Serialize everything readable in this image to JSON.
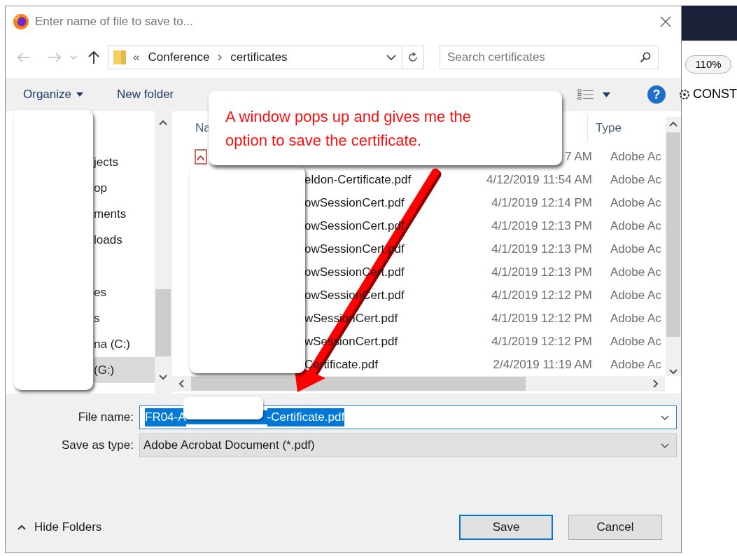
{
  "dialog": {
    "title": "Enter name of file to save to...",
    "address": {
      "prefix": "«",
      "crumbs": [
        "Conference",
        "certificates"
      ]
    },
    "search": {
      "placeholder": "Search certificates"
    },
    "toolbar": {
      "organize": "Organize",
      "new_folder": "New folder",
      "help": "?"
    },
    "sidebar": {
      "items": [
        {
          "label": "jects",
          "selected": false,
          "gap_before": false
        },
        {
          "label": "op",
          "selected": false,
          "gap_before": false
        },
        {
          "label": "ments",
          "selected": false,
          "gap_before": false
        },
        {
          "label": "loads",
          "selected": false,
          "gap_before": false
        },
        {
          "label": "es",
          "selected": false,
          "gap_before": true
        },
        {
          "label": "s",
          "selected": false,
          "gap_before": false
        },
        {
          "label": "na (C:)",
          "selected": false,
          "gap_before": false
        },
        {
          "label": "(G:)",
          "selected": true,
          "gap_before": false
        }
      ]
    },
    "files": {
      "columns": {
        "name": "Na",
        "type": "Type"
      },
      "rows": [
        {
          "date": "7 AM",
          "type": "Adobe Ac"
        },
        {
          "name": "eldon-Certificate.pdf",
          "date": "4/12/2019 11:54 AM",
          "type": "Adobe Ac"
        },
        {
          "name": "owSessionCert.pdf",
          "date": "4/1/2019 12:14 PM",
          "type": "Adobe Ac"
        },
        {
          "name": "owSessionCert.pdf",
          "date": "4/1/2019 12:13 PM",
          "type": "Adobe Ac"
        },
        {
          "name": "owSessionCert.pdf",
          "date": "4/1/2019 12:13 PM",
          "type": "Adobe Ac"
        },
        {
          "name": "owSessionCert.pdf",
          "date": "4/1/2019 12:13 PM",
          "type": "Adobe Ac"
        },
        {
          "name": "owSessionCert.pdf",
          "date": "4/1/2019 12:12 PM",
          "type": "Adobe Ac"
        },
        {
          "name": "wSessionCert.pdf",
          "date": "4/1/2019 12:12 PM",
          "type": "Adobe Ac"
        },
        {
          "name": "wSessionCert.pdf",
          "date": "4/1/2019 12:12 PM",
          "type": "Adobe Ac"
        },
        {
          "name": "Certificate.pdf",
          "date": "2/4/2019 11:19 AM",
          "type": "Adobe Ac"
        }
      ]
    },
    "file_name": {
      "label": "File name:",
      "value_start": "FR04-A",
      "value_end": "-Certificate.pdf"
    },
    "save_as_type": {
      "label": "Save as type:",
      "value": "Adobe Acrobat Document (*.pdf)"
    },
    "hide_folders": "Hide Folders",
    "buttons": {
      "save": "Save",
      "cancel": "Cancel"
    }
  },
  "background": {
    "zoom": "110%",
    "label": "CONST"
  },
  "annotation": {
    "callout": "A window pops up and gives me the option to save the certificate."
  }
}
